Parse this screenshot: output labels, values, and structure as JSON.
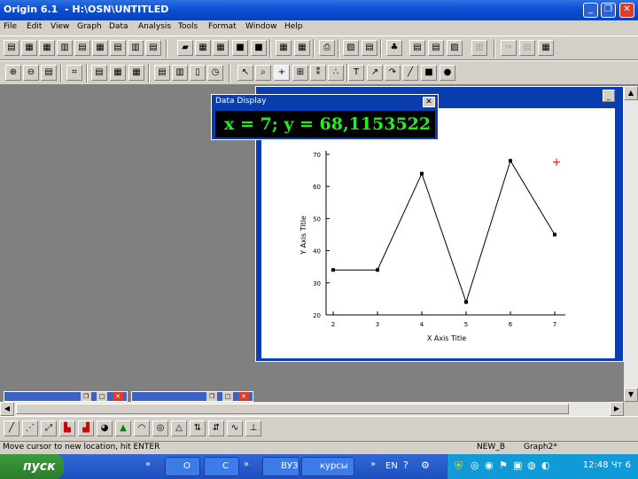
{
  "titlebar": {
    "title": "Origin 6.1  - H:\\OSN\\UNTITLED"
  },
  "menu": [
    "File",
    "Edit",
    "View",
    "Graph",
    "Data",
    "Analysis",
    "Tools",
    "Format",
    "Window",
    "Help"
  ],
  "data_display": {
    "title": "Data Display",
    "readout": "x = 7; y = 68,1153522"
  },
  "chart_data": {
    "type": "line",
    "x": [
      2,
      3,
      4,
      5,
      6,
      7
    ],
    "y": [
      34,
      34,
      64,
      24,
      68,
      45
    ],
    "marker_point": {
      "x": 7,
      "y": 68.1153522
    },
    "xlabel": "X Axis Title",
    "ylabel": "Y Axis Title",
    "xlim": [
      2,
      7
    ],
    "ylim": [
      20,
      70
    ],
    "xticks": [
      "2",
      "3",
      "4",
      "5",
      "6",
      "7"
    ],
    "yticks": [
      "20",
      "30",
      "40",
      "50",
      "60",
      "70"
    ],
    "line_color": "#000000",
    "marker_color": "#cc0000"
  },
  "status": {
    "message": "Move cursor to new location, hit ENTER",
    "worksheet": "NEW_B",
    "graph": "Graph2*"
  },
  "taskbar": {
    "start_label": "пуск",
    "tasks": [
      "O",
      "C",
      "ВУЗ",
      "курсы"
    ],
    "lang": "EN",
    "clock": "12:48 Чт 6"
  }
}
